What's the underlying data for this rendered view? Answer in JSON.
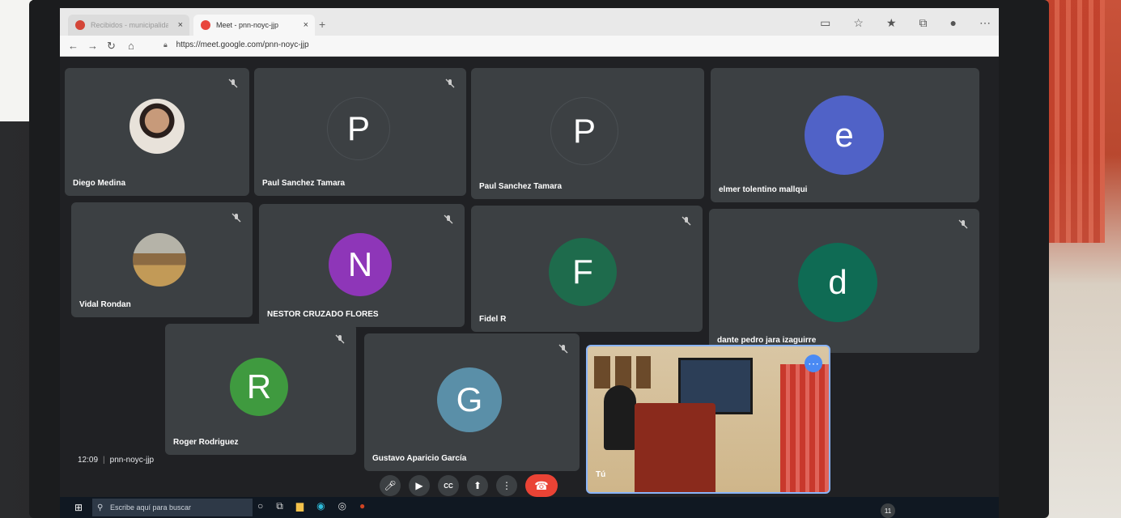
{
  "browser": {
    "tabs": [
      {
        "label": "Recibidos - municipalidaddecas",
        "active": false
      },
      {
        "label": "Meet - pnn-noyc-jjp",
        "active": true
      }
    ],
    "url": "https://meet.google.com/pnn-noyc-jjp"
  },
  "meet": {
    "participants": [
      {
        "name": "Diego Medina",
        "avatar_type": "photo-person"
      },
      {
        "name": "Paul Sanchez Tamara",
        "initial": "P",
        "color": "#3c4043"
      },
      {
        "name": "Paul Sanchez Tamara",
        "initial": "P",
        "color": "#3c4043"
      },
      {
        "name": "elmer tolentino mallqui",
        "initial": "e",
        "color": "#5062c7"
      },
      {
        "name": "Vidal Rondan",
        "avatar_type": "photo-landscape"
      },
      {
        "name": "NESTOR CRUZADO FLORES",
        "initial": "N",
        "color": "#8e36b8"
      },
      {
        "name": "Fidel R",
        "initial": "F",
        "color": "#1e6b4c"
      },
      {
        "name": "dante pedro jara izaguirre",
        "initial": "d",
        "color": "#0f6b54"
      },
      {
        "name": "Roger Rodriguez",
        "initial": "R",
        "color": "#3f9a3f"
      },
      {
        "name": "Gustavo Aparicio García",
        "initial": "G",
        "color": "#5a8fa8"
      }
    ],
    "self_tile": {
      "name": "Tú"
    },
    "time": "12:09",
    "meeting_code": "pnn-noyc-jjp"
  },
  "taskbar": {
    "search_placeholder": "Escribe aquí para buscar",
    "notification_count": "11"
  }
}
